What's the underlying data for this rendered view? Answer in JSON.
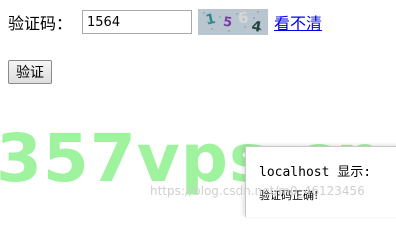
{
  "form": {
    "captcha_label": "验证码：",
    "captcha_value": "1564",
    "captcha_image_text": "1564",
    "refresh_link": "看不清",
    "verify_button": "验证"
  },
  "alert": {
    "title": "localhost 显示:",
    "message": "验证码正确!"
  },
  "watermarks": {
    "site": "357vps.cn",
    "blog": "https://blog.csdn.net/m0_46123456"
  },
  "colors": {
    "link": "#0000ee",
    "watermark": "#9ff39f",
    "captcha_bg": "#b9c6cf"
  }
}
